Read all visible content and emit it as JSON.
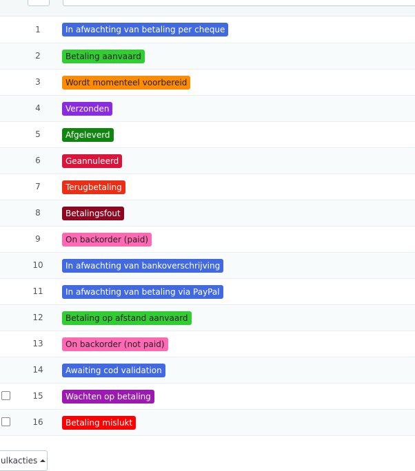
{
  "statuses": [
    {
      "id": "1",
      "name": "In afwachting van betaling per cheque",
      "color": "#4169e1",
      "text_color": "#ffffff",
      "has_checkbox": false
    },
    {
      "id": "2",
      "name": "Betaling aanvaard",
      "color": "#32cd32",
      "text_color": "#222222",
      "has_checkbox": false
    },
    {
      "id": "3",
      "name": "Wordt momenteel voorbereid",
      "color": "#ff8c00",
      "text_color": "#222222",
      "has_checkbox": false
    },
    {
      "id": "4",
      "name": "Verzonden",
      "color": "#8a2be2",
      "text_color": "#ffffff",
      "has_checkbox": false
    },
    {
      "id": "5",
      "name": "Afgeleverd",
      "color": "#108510",
      "text_color": "#ffffff",
      "has_checkbox": false
    },
    {
      "id": "6",
      "name": "Geannuleerd",
      "color": "#dc143c",
      "text_color": "#ffffff",
      "has_checkbox": false
    },
    {
      "id": "7",
      "name": "Terugbetaling",
      "color": "#ec2e15",
      "text_color": "#ffffff",
      "has_checkbox": false
    },
    {
      "id": "8",
      "name": "Betalingsfout",
      "color": "#8f0621",
      "text_color": "#ffffff",
      "has_checkbox": false
    },
    {
      "id": "9",
      "name": "On backorder (paid)",
      "color": "#ff69b4",
      "text_color": "#222222",
      "has_checkbox": false
    },
    {
      "id": "10",
      "name": "In afwachting van bankoverschrijving",
      "color": "#4169e1",
      "text_color": "#ffffff",
      "has_checkbox": false
    },
    {
      "id": "11",
      "name": "In afwachting van betaling via PayPal",
      "color": "#4169e1",
      "text_color": "#ffffff",
      "has_checkbox": false
    },
    {
      "id": "12",
      "name": "Betaling op afstand aanvaard",
      "color": "#32cd32",
      "text_color": "#222222",
      "has_checkbox": false
    },
    {
      "id": "13",
      "name": "On backorder (not paid)",
      "color": "#ff69b4",
      "text_color": "#222222",
      "has_checkbox": false
    },
    {
      "id": "14",
      "name": "Awaiting cod validation",
      "color": "#4169e1",
      "text_color": "#ffffff",
      "has_checkbox": false
    },
    {
      "id": "15",
      "name": "Wachten op betaling",
      "color": "#9c1ab1",
      "text_color": "#ffffff",
      "has_checkbox": true
    },
    {
      "id": "16",
      "name": "Betaling mislukt",
      "color": "#ff0000",
      "text_color": "#ffffff",
      "has_checkbox": true
    }
  ],
  "bulk_actions": {
    "label": "ulkacties",
    "icon": "caret-up-icon"
  }
}
